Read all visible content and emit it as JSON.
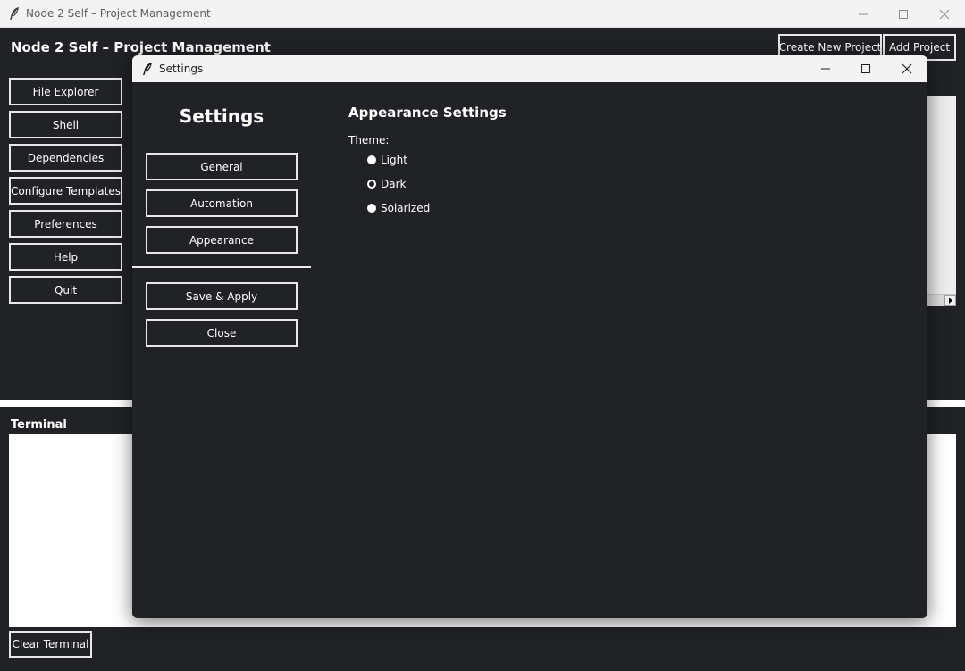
{
  "window": {
    "title": "Node 2 Self – Project Management",
    "heading": "Node 2 Self – Project Management"
  },
  "toolbar": {
    "create_new_project": "Create New Project",
    "add_project": "Add Project"
  },
  "sidebar": {
    "items": [
      {
        "label": "File Explorer"
      },
      {
        "label": "Shell"
      },
      {
        "label": "Dependencies"
      },
      {
        "label": "Configure Templates"
      },
      {
        "label": "Preferences"
      },
      {
        "label": "Help"
      },
      {
        "label": "Quit"
      }
    ]
  },
  "terminal": {
    "label": "Terminal",
    "clear_button": "Clear Terminal"
  },
  "settings_dialog": {
    "title": "Settings",
    "heading": "Settings",
    "nav": [
      {
        "label": "General"
      },
      {
        "label": "Automation"
      },
      {
        "label": "Appearance"
      }
    ],
    "actions": {
      "save_apply": "Save & Apply",
      "close": "Close"
    },
    "appearance": {
      "heading": "Appearance Settings",
      "theme_label": "Theme:",
      "options": [
        {
          "label": "Light",
          "selected": false
        },
        {
          "label": "Dark",
          "selected": true
        },
        {
          "label": "Solarized",
          "selected": false
        }
      ]
    }
  },
  "icons": {
    "app": "feather-icon",
    "minimize": "minimize-icon",
    "maximize": "maximize-icon",
    "close": "close-icon",
    "scroll_right": "arrow-right-icon"
  }
}
